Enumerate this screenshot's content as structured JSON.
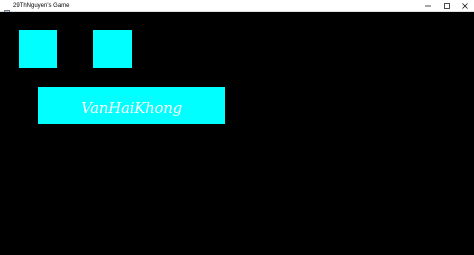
{
  "window": {
    "title": "29ThNguyen's Game",
    "app_icon": "window-app-icon"
  },
  "controls": {
    "minimize_icon": "minimize-icon",
    "maximize_icon": "maximize-icon",
    "close_icon": "close-icon"
  },
  "game": {
    "background_color": "#000000",
    "block_color": "#00ffff",
    "banner_text": "VanHaiKhong",
    "banner_text_color": "#ffffff"
  }
}
